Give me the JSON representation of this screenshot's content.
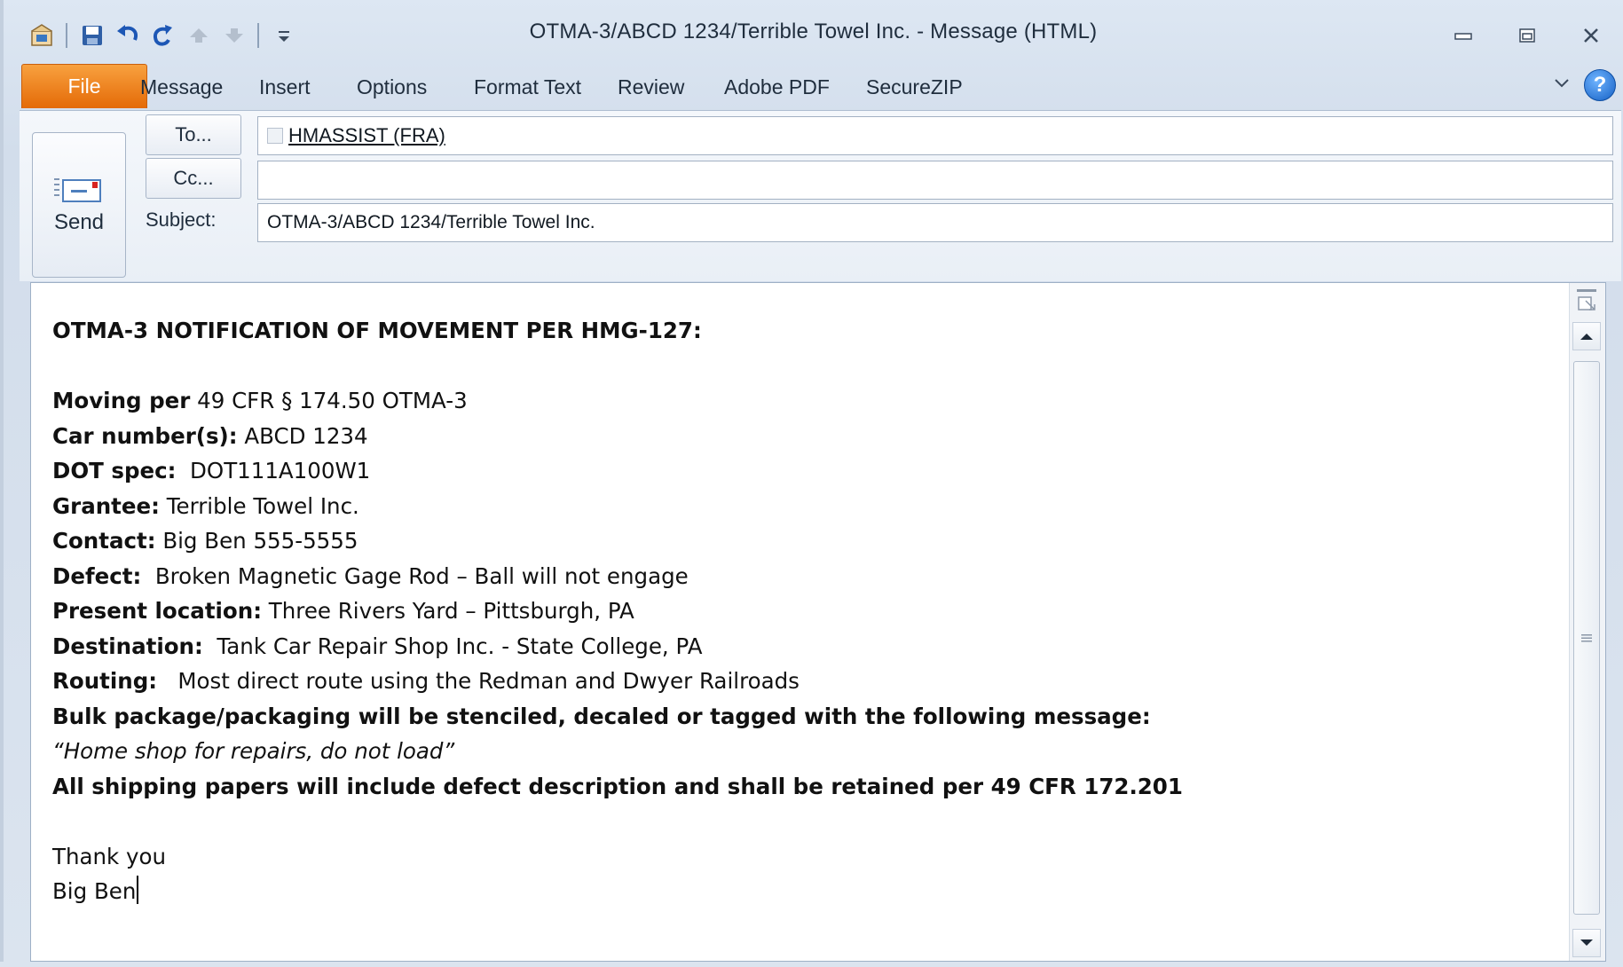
{
  "window": {
    "title": "OTMA-3/ABCD 1234/Terrible Towel Inc.  - Message (HTML)"
  },
  "quick_access": {
    "icons": [
      "outlook-app-icon",
      "save-icon",
      "undo-icon",
      "redo-icon",
      "up-arrow-icon",
      "down-arrow-icon",
      "customize-qat-icon"
    ]
  },
  "ribbon": {
    "tabs": [
      "File",
      "Message",
      "Insert",
      "Options",
      "Format Text",
      "Review",
      "Adobe PDF",
      "SecureZIP"
    ],
    "help_label": "?"
  },
  "header": {
    "send_label": "Send",
    "to_button": "To...",
    "cc_button": "Cc...",
    "subject_label": "Subject:",
    "to_value": "HMASSIST (FRA)",
    "cc_value": "",
    "subject_value": "OTMA-3/ABCD 1234/Terrible Towel Inc."
  },
  "body": {
    "heading": "OTMA-3 NOTIFICATION OF MOVEMENT PER HMG-127:",
    "moving_per_label": "Moving per",
    "moving_per_value": " 49 CFR § 174.50 OTMA-3",
    "car_label": "Car number(s):",
    "car_value": " ABCD 1234",
    "dot_label": "DOT spec:",
    "dot_value": "  DOT111A100W1",
    "grantee_label": "Grantee:",
    "grantee_value": " Terrible Towel Inc.",
    "contact_label": "Contact:",
    "contact_value": " Big Ben 555-5555",
    "defect_label": "Defect:",
    "defect_value": "  Broken Magnetic Gage Rod – Ball will not engage",
    "location_label": "Present location:",
    "location_value": " Three Rivers Yard – Pittsburgh, PA",
    "destination_label": "Destination:",
    "destination_value": "  Tank Car Repair Shop Inc. - State College, PA",
    "routing_label": "Routing:",
    "routing_value": "   Most direct route using the Redman and Dwyer Railroads",
    "stencil_line": "Bulk package/packaging will be stenciled, decaled or tagged with the following message:",
    "stencil_message": "“Home shop for repairs, do not load”",
    "papers_line": "All shipping papers will include defect description and shall be retained per 49 CFR 172.201",
    "closing": "Thank you",
    "signature": "Big Ben"
  },
  "colors": {
    "file_tab": "#e46a07",
    "chrome": "#d2ddeb",
    "help": "#1560c4"
  }
}
